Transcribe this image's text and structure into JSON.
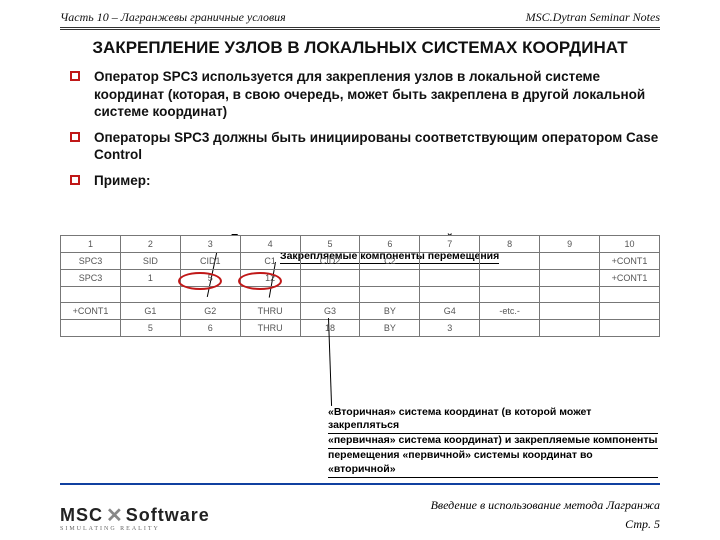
{
  "header": {
    "left": "Часть 10 – Лагранжевы граничные условия",
    "right": "MSC.Dytran Seminar Notes"
  },
  "title": "ЗАКРЕПЛЕНИЕ УЗЛОВ В ЛОКАЛЬНЫХ СИСТЕМАХ КООРДИНАТ",
  "bullets": [
    "Оператор SPC3 используется для закрепления узлов в локальной системе координат (которая, в свою очередь, может быть закреплена в другой локальной системе координат)",
    "Операторы SPC3 должны быть инициированы соответствующим оператором Case Control",
    "Пример:"
  ],
  "callouts": {
    "c1": "«Первичная» система координат, в которой закрепляются узлы",
    "c2": "Закрепляемые компоненты перемещения",
    "box1": "«Вторичная» система координат (в которой может закрепляться",
    "box2": "«первичная» система координат) и закрепляемые компоненты",
    "box3": "перемещения «первичной» системы координат во «вторичной»"
  },
  "table": {
    "cols": [
      "1",
      "2",
      "3",
      "4",
      "5",
      "6",
      "7",
      "8",
      "9",
      "10"
    ],
    "rows": [
      [
        "SPC3",
        "SID",
        "CID1",
        "C1",
        "CID2",
        "C2",
        "",
        "",
        "",
        "+CONT1"
      ],
      [
        "SPC3",
        "1",
        "5",
        "12",
        "",
        "",
        "",
        "",
        "",
        "+CONT1"
      ],
      [
        "",
        "",
        "",
        "",
        "",
        "",
        "",
        "",
        "",
        ""
      ],
      [
        "+CONT1",
        "G1",
        "G2",
        "THRU",
        "G3",
        "BY",
        "G4",
        "-etc.-",
        "",
        ""
      ],
      [
        "",
        "5",
        "6",
        "THRU",
        "18",
        "BY",
        "3",
        "",
        "",
        ""
      ]
    ]
  },
  "footer": {
    "logoMain1": "MSC",
    "logoMain2": "Software",
    "logoSub": "SIMULATING REALITY",
    "right": "Введение в использование метода Лагранжа",
    "page": "Стр. 5"
  }
}
